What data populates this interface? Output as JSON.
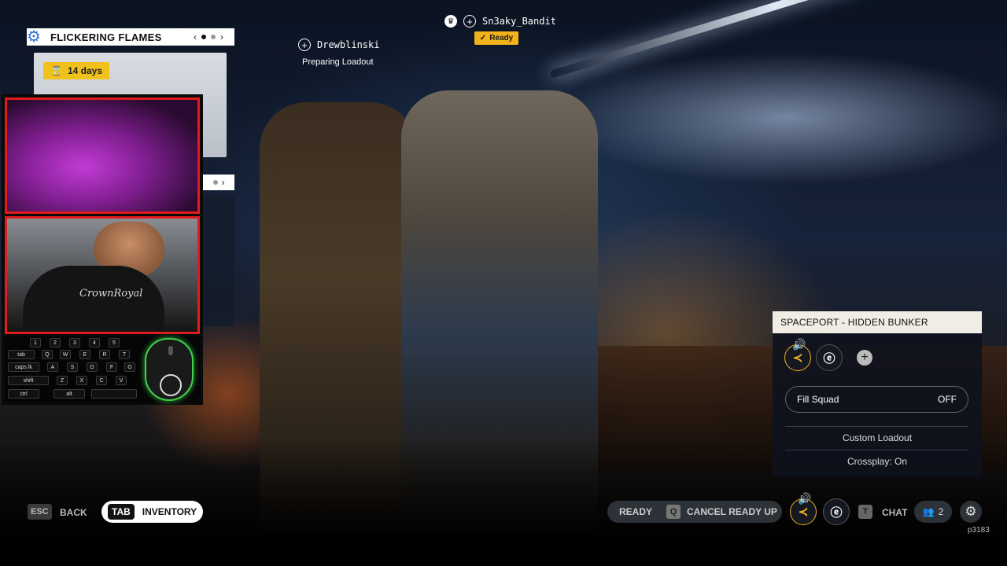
{
  "playlist": {
    "title": "FLICKERING FLAMES",
    "days_badge": "14 days",
    "prev_arrow": "‹",
    "next_arrow": "›"
  },
  "overlay": {
    "shirt_text": "CrownRoyal",
    "keyboard_keys": [
      "1",
      "2",
      "3",
      "4",
      "5",
      "tab",
      "Q",
      "W",
      "E",
      "R",
      "T",
      "caps lk",
      "A",
      "S",
      "D",
      "F",
      "G",
      "shift",
      "Z",
      "X",
      "C",
      "V",
      "ctrl",
      "alt"
    ]
  },
  "party": {
    "member1": {
      "name": "Drewblinski",
      "status": "Preparing Loadout"
    },
    "member2": {
      "name": "Sn3aky_Bandit",
      "status": "Ready"
    }
  },
  "lobby": {
    "map_title": "SPACEPORT - HIDDEN BUNKER",
    "fill_squad_label": "Fill Squad",
    "fill_squad_value": "OFF",
    "custom_loadout": "Custom Loadout",
    "crossplay": "Crossplay: On"
  },
  "bottom": {
    "esc_key": "ESC",
    "back_label": "BACK",
    "tab_key": "TAB",
    "inventory_label": "INVENTORY",
    "ready_label": "READY",
    "cancel_key": "Q",
    "cancel_label": "CANCEL READY UP",
    "chat_key": "T",
    "chat_label": "CHAT",
    "party_count": "2",
    "build_id": "p3183"
  },
  "colors": {
    "accent_yellow": "#f2b21a",
    "webcam_border": "#e11b1b",
    "mouse_glow": "#3fd14a"
  }
}
